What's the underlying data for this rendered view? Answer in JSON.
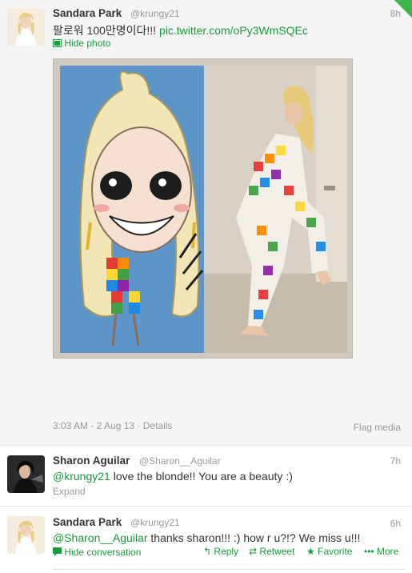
{
  "tweets": [
    {
      "name": "Sandara Park",
      "handle": "@krungy21",
      "time": "8h",
      "text_prefix": "팔로워 100만명이다!!! ",
      "link": "pic.twitter.com/oPy3WmSQEc",
      "toggle": "Hide photo",
      "meta": "3:03 AM - 2 Aug 13 · Details",
      "flag": "Flag media"
    },
    {
      "name": "Sharon Aguilar",
      "handle": "@Sharon__Aguilar",
      "time": "7h",
      "mention": "@krungy21",
      "text": " love the blonde!! You are a beauty :)",
      "expand": "Expand"
    },
    {
      "name": "Sandara Park",
      "handle": "@krungy21",
      "time": "6h",
      "mention": "@Sharon__Aguilar",
      "text": " thanks sharon!!! :) how r u?!? We miss u!!!",
      "toggle": "Hide conversation",
      "actions": {
        "reply": "Reply",
        "retweet": "Retweet",
        "favorite": "Favorite",
        "more": "More"
      }
    }
  ],
  "icons": {
    "reply": "reply-arrow-icon",
    "retweet": "retweet-icon",
    "favorite": "star-icon",
    "more": "ellipsis-icon",
    "photo": "photo-icon",
    "conversation": "conversation-icon"
  },
  "colors": {
    "link": "#1a9a3a",
    "muted": "#999999",
    "text": "#333333",
    "selected_bg": "#f5f5f5"
  }
}
